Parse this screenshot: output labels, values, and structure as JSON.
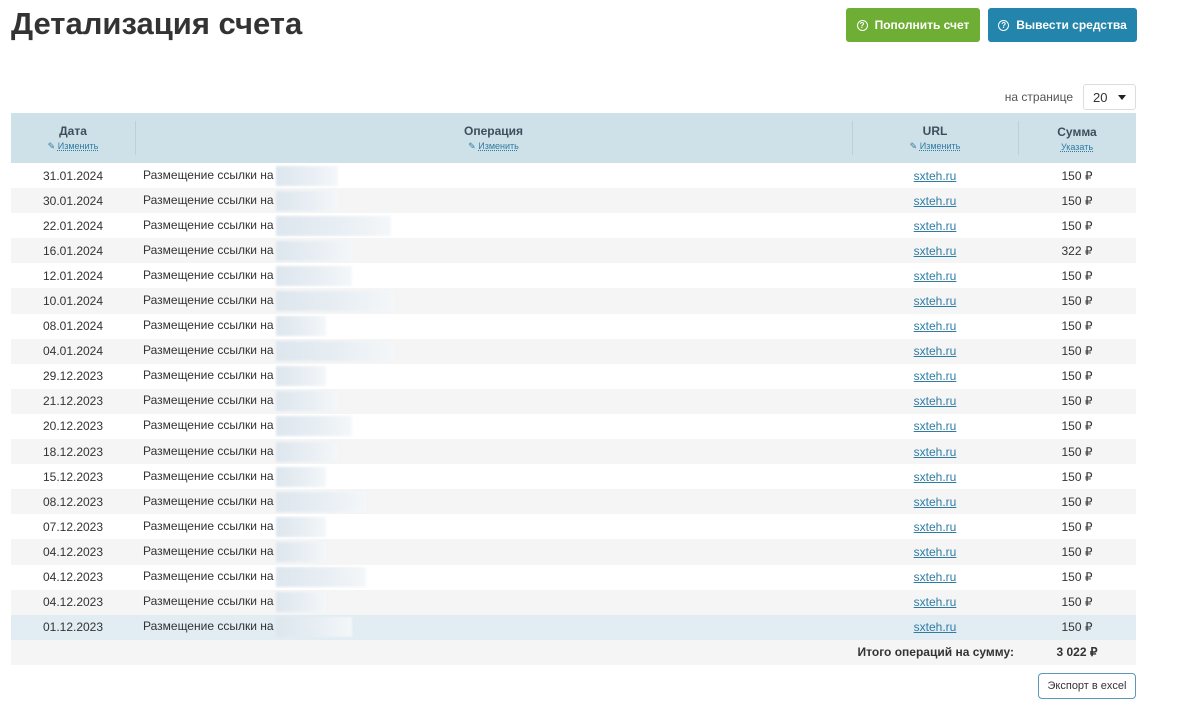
{
  "title": "Детализация счета",
  "buttons": {
    "deposit": "Пополнить счет",
    "withdraw": "Вывести средства",
    "export": "Экспорт в excel"
  },
  "per_page": {
    "label": "на странице",
    "value": "20"
  },
  "columns": {
    "date": "Дата",
    "operation": "Операция",
    "url": "URL",
    "sum": "Сумма",
    "change": "Изменить",
    "specify": "Указать"
  },
  "rows": [
    {
      "date": "31.01.2024",
      "op": "Размещение ссылки на",
      "url": "sxteh.ru",
      "sum": "150 ₽"
    },
    {
      "date": "30.01.2024",
      "op": "Размещение ссылки на",
      "url": "sxteh.ru",
      "sum": "150 ₽"
    },
    {
      "date": "22.01.2024",
      "op": "Размещение ссылки на",
      "url": "sxteh.ru",
      "sum": "150 ₽"
    },
    {
      "date": "16.01.2024",
      "op": "Размещение ссылки на",
      "url": "sxteh.ru",
      "sum": "322 ₽"
    },
    {
      "date": "12.01.2024",
      "op": "Размещение ссылки на",
      "url": "sxteh.ru",
      "sum": "150 ₽"
    },
    {
      "date": "10.01.2024",
      "op": "Размещение ссылки на",
      "url": "sxteh.ru",
      "sum": "150 ₽"
    },
    {
      "date": "08.01.2024",
      "op": "Размещение ссылки на",
      "url": "sxteh.ru",
      "sum": "150 ₽"
    },
    {
      "date": "04.01.2024",
      "op": "Размещение ссылки на",
      "url": "sxteh.ru",
      "sum": "150 ₽"
    },
    {
      "date": "29.12.2023",
      "op": "Размещение ссылки на",
      "url": "sxteh.ru",
      "sum": "150 ₽"
    },
    {
      "date": "21.12.2023",
      "op": "Размещение ссылки на",
      "url": "sxteh.ru",
      "sum": "150 ₽"
    },
    {
      "date": "20.12.2023",
      "op": "Размещение ссылки на",
      "url": "sxteh.ru",
      "sum": "150 ₽"
    },
    {
      "date": "18.12.2023",
      "op": "Размещение ссылки на",
      "url": "sxteh.ru",
      "sum": "150 ₽"
    },
    {
      "date": "15.12.2023",
      "op": "Размещение ссылки на",
      "url": "sxteh.ru",
      "sum": "150 ₽"
    },
    {
      "date": "08.12.2023",
      "op": "Размещение ссылки на",
      "url": "sxteh.ru",
      "sum": "150 ₽"
    },
    {
      "date": "07.12.2023",
      "op": "Размещение ссылки на",
      "url": "sxteh.ru",
      "sum": "150 ₽"
    },
    {
      "date": "04.12.2023",
      "op": "Размещение ссылки на",
      "url": "sxteh.ru",
      "sum": "150 ₽"
    },
    {
      "date": "04.12.2023",
      "op": "Размещение ссылки на",
      "url": "sxteh.ru",
      "sum": "150 ₽"
    },
    {
      "date": "04.12.2023",
      "op": "Размещение ссылки на",
      "url": "sxteh.ru",
      "sum": "150 ₽"
    },
    {
      "date": "01.12.2023",
      "op": "Размещение ссылки на",
      "url": "sxteh.ru",
      "sum": "150 ₽"
    }
  ],
  "total": {
    "label": "Итого операций на сумму:",
    "value": "3 022 ₽"
  }
}
